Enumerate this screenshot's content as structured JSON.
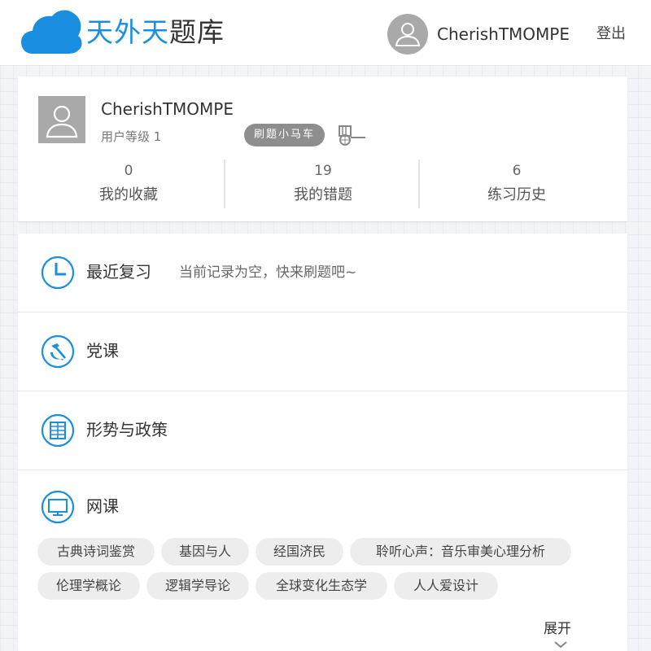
{
  "header": {
    "logo_icon": "cloud-icon",
    "title_part1": "天外天",
    "title_part2": "题库",
    "username": "CherishTMOMPE",
    "logout_label": "登出"
  },
  "profile": {
    "username": "CherishTMOMPE",
    "level_label": "用户等级 1",
    "badge": "刷题小马车",
    "badge_icon": "carriage-icon",
    "stats": [
      {
        "value": "0",
        "label": "我的收藏"
      },
      {
        "value": "19",
        "label": "我的错题"
      },
      {
        "value": "6",
        "label": "练习历史"
      }
    ]
  },
  "menu": {
    "recent": {
      "label": "最近复习",
      "hint": "当前记录为空，快来刷题吧~",
      "icon": "clock-icon"
    },
    "party": {
      "label": "党课",
      "icon": "hammer-sickle-icon"
    },
    "policy": {
      "label": "形势与政策",
      "icon": "document-grid-icon"
    },
    "online": {
      "label": "网课",
      "icon": "monitor-icon",
      "courses": [
        "古典诗词鉴赏",
        "基因与人",
        "经国济民",
        "聆听心声：音乐审美心理分析",
        "伦理学概论",
        "逻辑学导论",
        "全球变化生态学",
        "人人爱设计"
      ],
      "expand_label": "展开"
    }
  },
  "colors": {
    "accent": "#1a8fe0",
    "badge": "#8e8e8e",
    "tag_bg": "#ededed"
  }
}
